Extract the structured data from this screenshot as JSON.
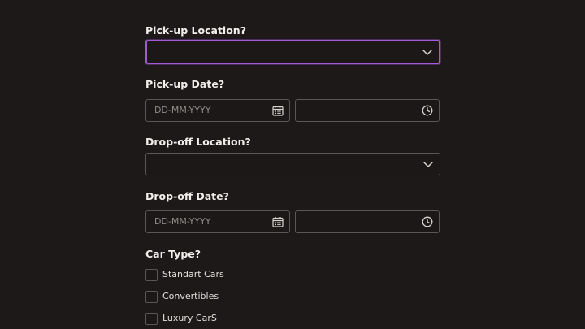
{
  "form": {
    "pickup_location": {
      "label": "Pick-up Location?",
      "value": ""
    },
    "pickup_date": {
      "label": "Pick-up Date?",
      "date_placeholder": "DD-MM-YYYY",
      "time_value": ""
    },
    "dropoff_location": {
      "label": "Drop-off Location?",
      "value": ""
    },
    "dropoff_date": {
      "label": "Drop-off Date?",
      "date_placeholder": "DD-MM-YYYY",
      "time_value": ""
    },
    "car_type": {
      "label": "Car Type?",
      "options": [
        {
          "label": "Standart Cars",
          "checked": false
        },
        {
          "label": "Convertibles",
          "checked": false
        },
        {
          "label": "Luxury CarS",
          "checked": false
        }
      ]
    }
  },
  "icons": {
    "dropdown": "chevron-down-icon",
    "date": "calendar-icon",
    "time": "clock-icon"
  },
  "colors": {
    "background": "#1c1918",
    "focus_ring": "#a259d6",
    "border": "#5a5655",
    "text": "#ece9e6",
    "placeholder": "#8f8a87"
  }
}
